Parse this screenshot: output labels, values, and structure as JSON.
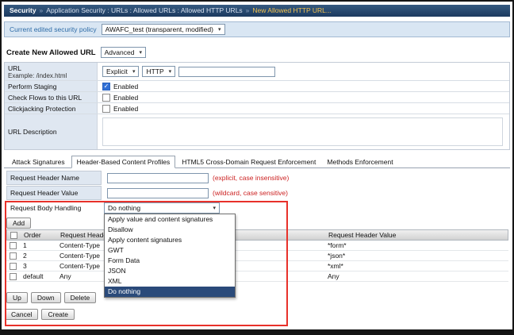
{
  "icons": {
    "dropdown_arrow": "▾",
    "check": "✓",
    "breadcrumb_sep": "»"
  },
  "colors": {
    "highlight_red": "#e8312a",
    "hint_red": "#cc2222",
    "header_navy": "#1c3a60",
    "breadcrumb_current_yellow": "#f2c14e",
    "selected_option_bg": "#2a4a7a"
  },
  "breadcrumb": {
    "section": "Security",
    "path": "Application Security : URLs : Allowed URLs : Allowed HTTP URLs",
    "current": "New Allowed HTTP URL..."
  },
  "policy_bar": {
    "label": "Current edited security policy",
    "value": "AWAFC_test (transparent, modified)"
  },
  "create": {
    "title": "Create New Allowed URL",
    "mode": "Advanced"
  },
  "url_form": {
    "url_label": "URL",
    "url_example": "Example: /index.html",
    "type_value": "Explicit",
    "protocol_value": "HTTP",
    "staging_label": "Perform Staging",
    "flows_label": "Check Flows to this URL",
    "clickjacking_label": "Clickjacking Protection",
    "enabled_label": "Enabled",
    "description_label": "URL Description"
  },
  "tabs": [
    {
      "label": "Attack Signatures"
    },
    {
      "label": "Header-Based Content Profiles"
    },
    {
      "label": "HTML5 Cross-Domain Request Enforcement"
    },
    {
      "label": "Methods Enforcement"
    }
  ],
  "header_form": {
    "name_label": "Request Header Name",
    "name_hint": "(explicit, case insensitive)",
    "value_label": "Request Header Value",
    "value_hint": "(wildcard, case sensitive)",
    "body_label": "Request Body Handling",
    "body_value": "Do nothing",
    "add_label": "Add"
  },
  "dropdown": {
    "options": [
      "Apply value and content signatures",
      "Disallow",
      "Apply content signatures",
      "GWT",
      "Form Data",
      "JSON",
      "XML",
      "Do nothing"
    ],
    "selected": "Do nothing"
  },
  "table": {
    "columns": {
      "order": "Order",
      "name": "Request Header Name",
      "value": "Request Header Value"
    },
    "rows": [
      {
        "order": "1",
        "name": "Content-Type",
        "value": "*form*"
      },
      {
        "order": "2",
        "name": "Content-Type",
        "value": "*json*"
      },
      {
        "order": "3",
        "name": "Content-Type",
        "value": "*xml*"
      },
      {
        "order": "default",
        "name": "Any",
        "value": "Any"
      }
    ]
  },
  "actions": {
    "up": "Up",
    "down": "Down",
    "delete": "Delete",
    "cancel": "Cancel",
    "create": "Create"
  }
}
